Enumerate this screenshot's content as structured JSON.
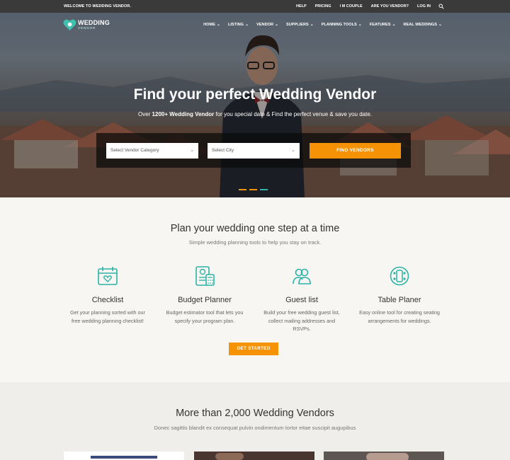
{
  "topbar": {
    "welcome": "WELCOME TO WEDDING VENDOR.",
    "links": [
      "HELP",
      "PRICING",
      "I M COUPLE",
      "ARE YOU VENDOR?",
      "LOG IN"
    ],
    "search_icon": "search-icon"
  },
  "logo": {
    "line1": "WEDDING",
    "line2": "VENDOR"
  },
  "nav": [
    {
      "label": "HOME"
    },
    {
      "label": "LISTING"
    },
    {
      "label": "VENDOR"
    },
    {
      "label": "SUPPLIERS"
    },
    {
      "label": "PLANNING TOOLS"
    },
    {
      "label": "FEATURES"
    },
    {
      "label": "REAL WEDDINGS"
    }
  ],
  "hero": {
    "title": "Find your perfect Wedding Vendor",
    "subtitle_prefix": "Over ",
    "subtitle_bold": "1200+ Wedding Vendor",
    "subtitle_rest": " for you special date & Find the perfect venue & save you date.",
    "category_placeholder": "Select Vendor Category",
    "city_placeholder": "Select City",
    "search_button": "FIND VENDORS",
    "slider_dots": 3
  },
  "planning": {
    "title": "Plan your wedding one step at a time",
    "subtitle": "Simple wedding planning tools to help you stay on track.",
    "tools": [
      {
        "title": "Checklist",
        "desc": "Get your planning sorted with our free wedding planning checklist!",
        "icon": "calendar-heart-icon"
      },
      {
        "title": "Budget Planner",
        "desc": "Budget estimator tool that lets you specify your program plan.",
        "icon": "calculator-icon"
      },
      {
        "title": "Guest list",
        "desc": "Build your free wedding guest list, collect mailing addresses and RSVPs.",
        "icon": "guests-icon"
      },
      {
        "title": "Table Planer",
        "desc": "Easy online tool for creating seating arrangements for weddings.",
        "icon": "table-seating-icon"
      }
    ],
    "cta": "GET STARTED"
  },
  "vendors": {
    "title": "More than 2,000 Wedding Vendors",
    "subtitle": "Donec sagittis blandit ex consequat pulvin ondimentum tortor eitae suscipit augupibus"
  },
  "colors": {
    "accent": "#f59206",
    "teal": "#2bb3a6",
    "dark": "#3a3a3a"
  }
}
